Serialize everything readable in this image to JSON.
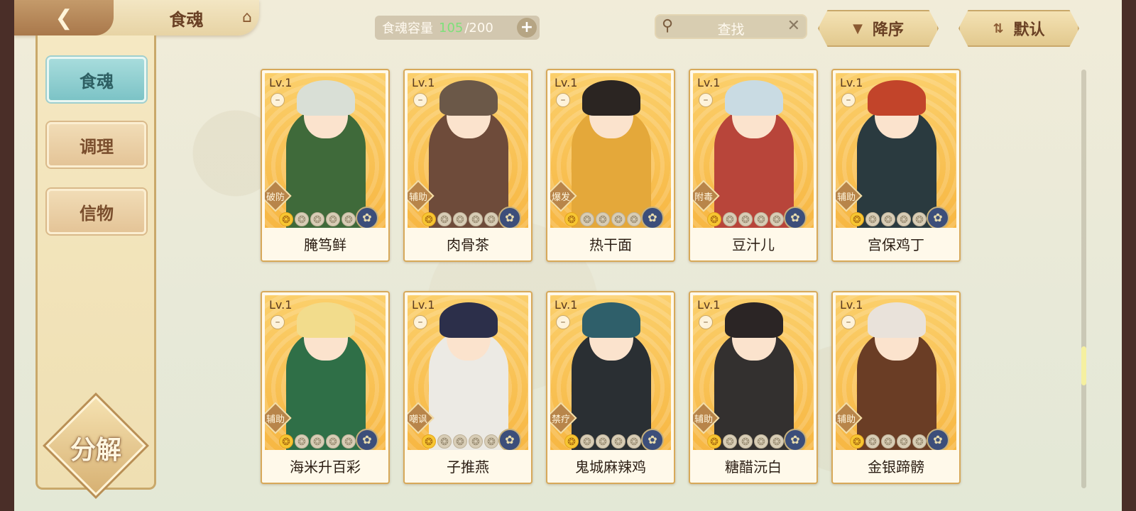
{
  "header": {
    "back_icon": "back-arrow-icon",
    "title": "食魂",
    "home_icon": "pavilion-icon"
  },
  "capacity": {
    "label": "食魂容量",
    "current": "105",
    "max": "/200",
    "add_label": "+"
  },
  "search": {
    "placeholder": "查找",
    "icon": "search-icon",
    "clear_label": "✕"
  },
  "sort": {
    "order_label": "降序",
    "order_icon": "▼",
    "default_label": "默认",
    "default_icon": "⇅"
  },
  "sidebar": {
    "items": [
      {
        "label": "食魂",
        "active": true
      },
      {
        "label": "调理",
        "active": false
      },
      {
        "label": "信物",
        "active": false
      }
    ],
    "decompose_label": "分解"
  },
  "cards": [
    {
      "level": "Lv.1",
      "role": "破防",
      "name": "腌笃鲜",
      "stars_filled": 1,
      "stars_total": 5,
      "hair": "#d9dfd6",
      "outfit": "#3f6a3a"
    },
    {
      "level": "Lv.1",
      "role": "辅助",
      "name": "肉骨茶",
      "stars_filled": 1,
      "stars_total": 5,
      "hair": "#6b5848",
      "outfit": "#6e4b3a"
    },
    {
      "level": "Lv.1",
      "role": "爆发",
      "name": "热干面",
      "stars_filled": 1,
      "stars_total": 5,
      "hair": "#2b2522",
      "outfit": "#e4a83a"
    },
    {
      "level": "Lv.1",
      "role": "附毒",
      "name": "豆汁儿",
      "stars_filled": 1,
      "stars_total": 5,
      "hair": "#c9dbe3",
      "outfit": "#b8453a"
    },
    {
      "level": "Lv.1",
      "role": "辅助",
      "name": "宫保鸡丁",
      "stars_filled": 1,
      "stars_total": 5,
      "hair": "#c2442a",
      "outfit": "#2a3a3f"
    },
    {
      "level": "Lv.1",
      "role": "辅助",
      "name": "海米升百彩",
      "stars_filled": 1,
      "stars_total": 5,
      "hair": "#f2dc8c",
      "outfit": "#2f6f47"
    },
    {
      "level": "Lv.1",
      "role": "嘲讽",
      "name": "子推燕",
      "stars_filled": 1,
      "stars_total": 5,
      "hair": "#2c2f4a",
      "outfit": "#eceae4"
    },
    {
      "level": "Lv.1",
      "role": "禁疗",
      "name": "鬼城麻辣鸡",
      "stars_filled": 1,
      "stars_total": 5,
      "hair": "#2f5f6a",
      "outfit": "#2a2f33"
    },
    {
      "level": "Lv.1",
      "role": "辅助",
      "name": "糖醋沅白",
      "stars_filled": 1,
      "stars_total": 5,
      "hair": "#2b2525",
      "outfit": "#33302f"
    },
    {
      "level": "Lv.1",
      "role": "辅助",
      "name": "金银蹄髈",
      "stars_filled": 1,
      "stars_total": 5,
      "hair": "#e9e2da",
      "outfit": "#6a3d25"
    }
  ],
  "card_common": {
    "lock_icon": "lock-icon",
    "element_icon": "flower-element-icon"
  }
}
